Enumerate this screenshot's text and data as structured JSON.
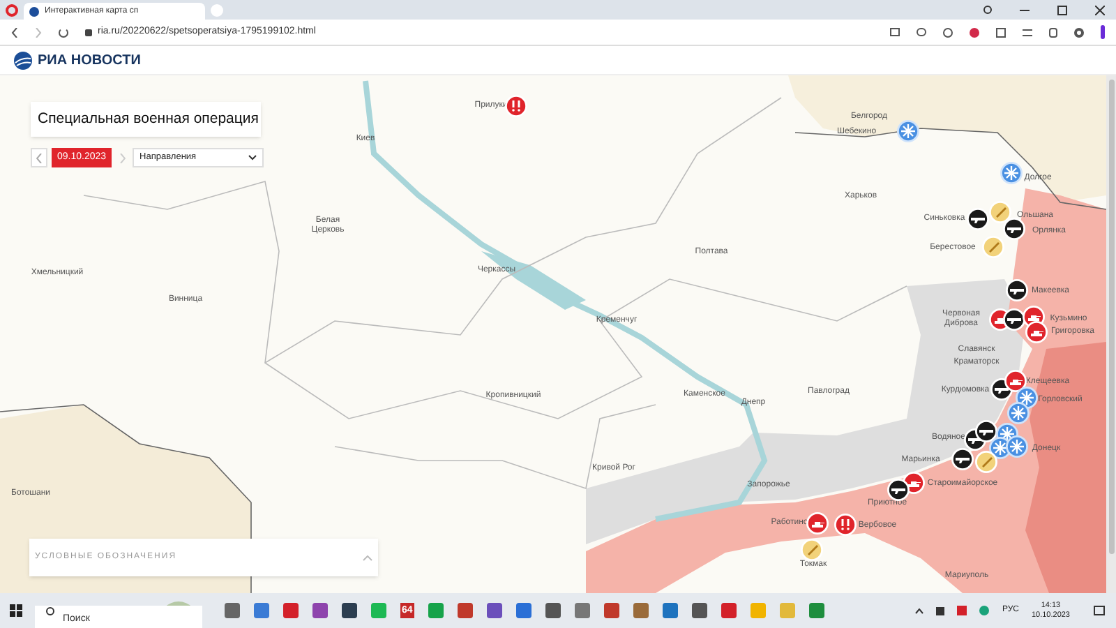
{
  "browser": {
    "tab_title": "Интерактивная карта сп",
    "url": "ria.ru/20220622/spetsoperatsiya-1795199102.html"
  },
  "site": {
    "logo": "РИА НОВОСТИ"
  },
  "panel": {
    "title": "Специальная военная операция",
    "date": "09.10.2023",
    "dropdown": "Направления",
    "legend": "УСЛОВНЫЕ ОБОЗНАЧЕНИЯ"
  },
  "cities": [
    {
      "name": "Прилуки"
    },
    {
      "name": "Киев"
    },
    {
      "name": "Белгород"
    },
    {
      "name": "Шебекино"
    },
    {
      "name": "Харьков"
    },
    {
      "name": "Белая Церковь"
    },
    {
      "name": "Хмельницкий"
    },
    {
      "name": "Винница"
    },
    {
      "name": "Черкассы"
    },
    {
      "name": "Полтава"
    },
    {
      "name": "Кременчуг"
    },
    {
      "name": "Кропивницкий"
    },
    {
      "name": "Каменское"
    },
    {
      "name": "Днепр"
    },
    {
      "name": "Павлоград"
    },
    {
      "name": "Кривой Рог"
    },
    {
      "name": "Запорожье"
    },
    {
      "name": "Ботошани"
    },
    {
      "name": "Долгое"
    },
    {
      "name": "Синьковка"
    },
    {
      "name": "Ольшана"
    },
    {
      "name": "Орлянка"
    },
    {
      "name": "Берестовое"
    },
    {
      "name": "Макеевка"
    },
    {
      "name": "Червоная Диброва"
    },
    {
      "name": "Кузьмино"
    },
    {
      "name": "Григоровка"
    },
    {
      "name": "Славянск"
    },
    {
      "name": "Краматорск"
    },
    {
      "name": "Клещеевка"
    },
    {
      "name": "Курдюмовка"
    },
    {
      "name": "Горловский"
    },
    {
      "name": "Водяное"
    },
    {
      "name": "Марьинка"
    },
    {
      "name": "Донецк"
    },
    {
      "name": "Староимайорское"
    },
    {
      "name": "Приютное"
    },
    {
      "name": "Работино"
    },
    {
      "name": "Вербовое"
    },
    {
      "name": "Токмак"
    },
    {
      "name": "Мариуполь"
    }
  ],
  "markers": [
    {
      "kind": "blast"
    },
    {
      "kind": "rocket"
    },
    {
      "kind": "rocket"
    },
    {
      "kind": "gun"
    },
    {
      "kind": "shell"
    },
    {
      "kind": "gun"
    },
    {
      "kind": "shell"
    },
    {
      "kind": "gun"
    },
    {
      "kind": "tank"
    },
    {
      "kind": "gun"
    },
    {
      "kind": "tank"
    },
    {
      "kind": "tank"
    },
    {
      "kind": "gun"
    },
    {
      "kind": "tank"
    },
    {
      "kind": "rocket"
    },
    {
      "kind": "rocket"
    },
    {
      "kind": "gun"
    },
    {
      "kind": "gun"
    },
    {
      "kind": "rocket"
    },
    {
      "kind": "rocket"
    },
    {
      "kind": "rocket"
    },
    {
      "kind": "gun"
    },
    {
      "kind": "shell"
    },
    {
      "kind": "tank"
    },
    {
      "kind": "gun"
    },
    {
      "kind": "tank"
    },
    {
      "kind": "blast"
    },
    {
      "kind": "shell"
    }
  ],
  "taskbar": {
    "search_placeholder": "Поиск",
    "app_badge": "64",
    "language": "РУС",
    "time": "14:13",
    "date": "10.10.2023"
  }
}
